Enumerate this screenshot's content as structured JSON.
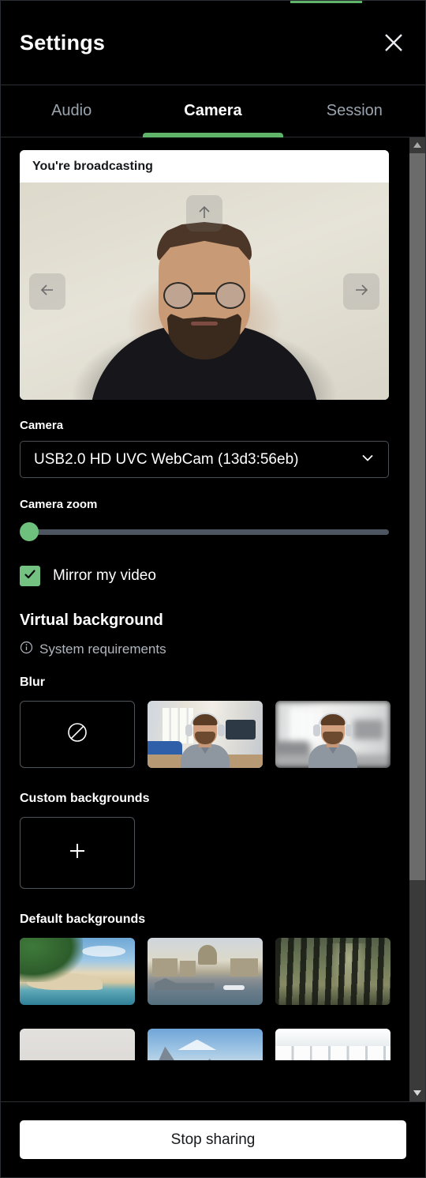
{
  "window": {
    "title": "Settings",
    "close_icon": "close-icon",
    "accent_color": "#5fb469"
  },
  "tabs": {
    "items": [
      {
        "label": "Audio",
        "active": false
      },
      {
        "label": "Camera",
        "active": true
      },
      {
        "label": "Session",
        "active": false
      }
    ]
  },
  "preview": {
    "banner_label": "You're broadcasting",
    "pan_up_icon": "arrow-up-icon",
    "pan_left_icon": "arrow-left-icon",
    "pan_right_icon": "arrow-right-icon"
  },
  "camera": {
    "label": "Camera",
    "selected_device": "USB2.0 HD UVC WebCam (13d3:56eb)",
    "chevron_icon": "chevron-down-icon"
  },
  "camera_zoom": {
    "label": "Camera zoom",
    "value": 0,
    "min": 0,
    "max": 100,
    "thumb_color": "#6ec17c",
    "track_color": "#4d5560"
  },
  "mirror": {
    "label": "Mirror my video",
    "checked": true,
    "check_icon": "checkmark-icon",
    "color": "#74c282"
  },
  "virtual_background": {
    "title": "Virtual background",
    "system_requirements_label": "System requirements",
    "info_icon": "info-icon",
    "blur": {
      "title": "Blur",
      "options": [
        {
          "name": "No blur",
          "icon": "no-blur-icon",
          "selected": false
        },
        {
          "name": "Light blur",
          "icon": "",
          "selected": false
        },
        {
          "name": "Strong blur",
          "icon": "",
          "selected": false
        }
      ]
    },
    "custom": {
      "title": "Custom backgrounds",
      "add_icon": "plus-icon",
      "add_label": ""
    },
    "defaults": {
      "title": "Default backgrounds",
      "row1": [
        {
          "name": "Tropical beach"
        },
        {
          "name": "City riverfront"
        },
        {
          "name": "Forest"
        }
      ],
      "row2": [
        {
          "name": "Neutral room"
        },
        {
          "name": "Snowy mountains"
        },
        {
          "name": "Modern office"
        }
      ]
    }
  },
  "scrollbar": {
    "up_arrow_icon": "caret-up-icon",
    "down_arrow_icon": "caret-down-icon",
    "thumb_color": "#6b6b6b",
    "track_color": "#3a3a3a"
  },
  "footer": {
    "stop_sharing_label": "Stop sharing"
  }
}
